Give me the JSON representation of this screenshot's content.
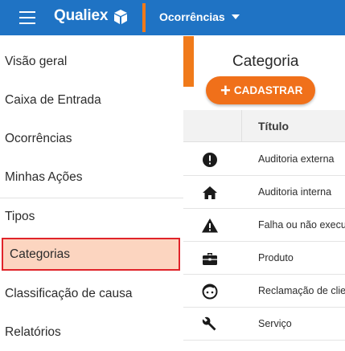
{
  "app": {
    "brand": "Qualiex",
    "module": "Ocorrências"
  },
  "sidebar": {
    "items": [
      {
        "label": "Visão geral"
      },
      {
        "label": "Caixa de Entrada"
      },
      {
        "label": "Ocorrências"
      },
      {
        "label": "Minhas Ações"
      },
      {
        "label": "Tipos"
      },
      {
        "label": "Categorias",
        "active": true
      },
      {
        "label": "Classificação de causa"
      },
      {
        "label": "Relatórios"
      }
    ]
  },
  "main": {
    "title": "Categoria",
    "add_button": {
      "icon": "plus-icon",
      "label": "CADASTRAR"
    },
    "table": {
      "columns": [
        "",
        "Título"
      ],
      "rows": [
        {
          "icon": "alert-circle-icon",
          "title": "Auditoria externa"
        },
        {
          "icon": "home-icon",
          "title": "Auditoria interna"
        },
        {
          "icon": "warning-triangle-icon",
          "title": "Falha ou não execução"
        },
        {
          "icon": "briefcase-icon",
          "title": "Produto"
        },
        {
          "icon": "face-icon",
          "title": "Reclamação de cliente"
        },
        {
          "icon": "wrench-icon",
          "title": "Serviço"
        }
      ]
    }
  },
  "colors": {
    "topbar": "#1f73c4",
    "accent": "#f07a1a",
    "active_bg": "#fcd5c0",
    "active_border": "#e0242a"
  }
}
